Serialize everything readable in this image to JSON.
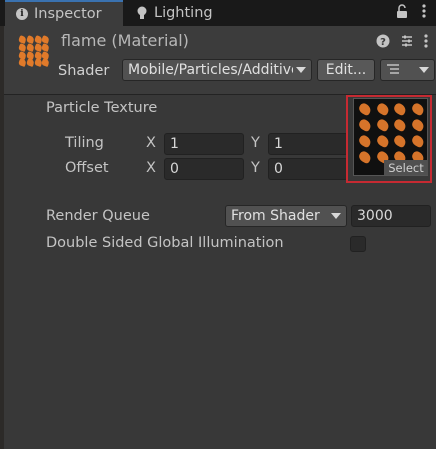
{
  "tabs": {
    "inspector": "Inspector",
    "lighting": "Lighting"
  },
  "icons": {
    "info": "info-icon",
    "bulb": "light-bulb-icon",
    "lock": "lock-icon",
    "more": "kebab-menu-icon",
    "help": "help-icon",
    "presets": "presets-icon",
    "menu": "kebab-menu-icon"
  },
  "header": {
    "material_name": "flame (Material)",
    "shader_label": "Shader",
    "shader_value": "Mobile/Particles/Additive",
    "edit_label": "Edit..."
  },
  "properties": {
    "particle_texture_label": "Particle Texture",
    "tiling_label": "Tiling",
    "tiling_x_label": "X",
    "tiling_x": "1",
    "tiling_y_label": "Y",
    "tiling_y": "1",
    "offset_label": "Offset",
    "offset_x_label": "X",
    "offset_x": "0",
    "offset_y_label": "Y",
    "offset_y": "0",
    "select_label": "Select",
    "render_queue_label": "Render Queue",
    "render_queue_mode": "From Shader",
    "render_queue_value": "3000",
    "double_sided_gi_label": "Double Sided Global Illumination"
  },
  "colors": {
    "panel_bg": "#383838",
    "tab_bar": "#191919",
    "highlight_frame": "#c62a32",
    "flame": "#d6742a"
  }
}
